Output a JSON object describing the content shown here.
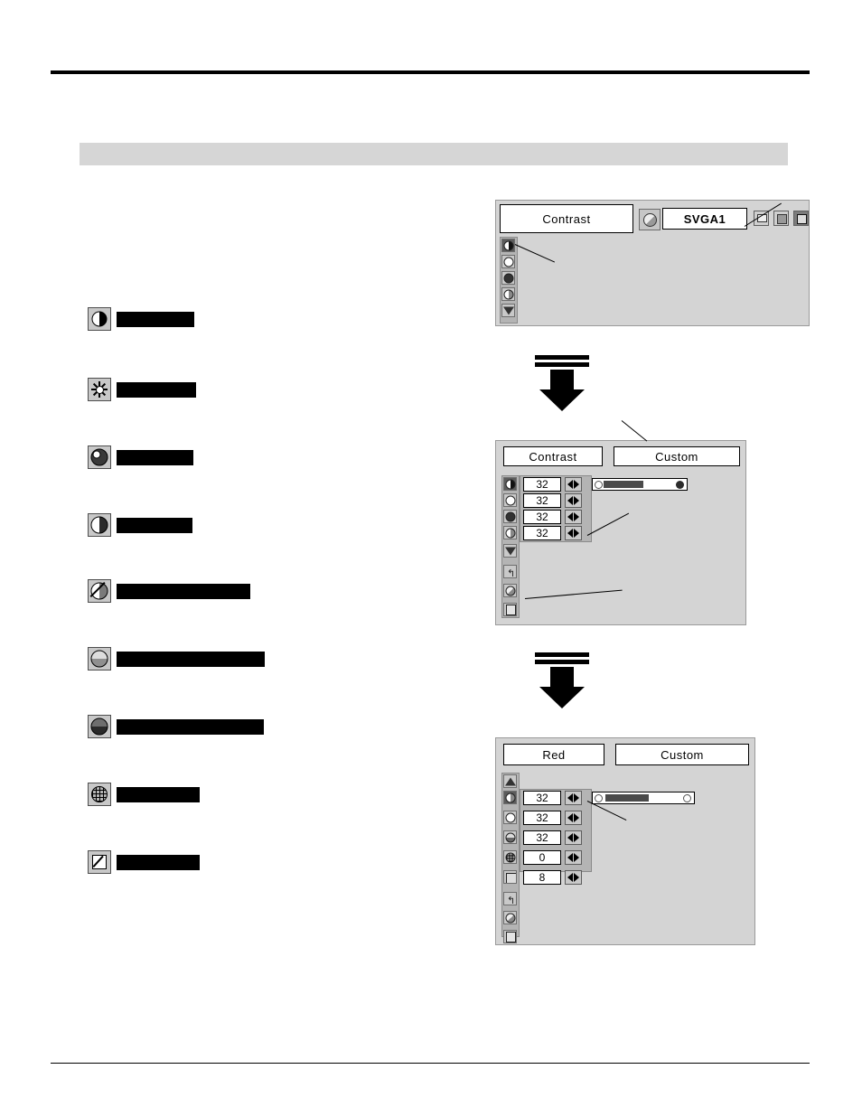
{
  "page": {
    "heading_band_label": "",
    "features": [
      {
        "icon": "contrast-icon",
        "label": ""
      },
      {
        "icon": "brightness-icon",
        "label": ""
      },
      {
        "icon": "color-icon",
        "label": ""
      },
      {
        "icon": "tint-icon",
        "label": ""
      },
      {
        "icon": "white-balance-red-icon",
        "label": ""
      },
      {
        "icon": "white-balance-green-icon",
        "label": ""
      },
      {
        "icon": "white-balance-blue-icon",
        "label": ""
      },
      {
        "icon": "sharpness-icon",
        "label": ""
      },
      {
        "icon": "gamma-icon",
        "label": ""
      }
    ]
  },
  "osd_top": {
    "title": "Contrast",
    "source": "SVGA1",
    "menu_icons": [
      "contrast-icon",
      "brightness-icon",
      "color-icon",
      "tint-icon",
      "arrow-down-icon"
    ],
    "toolbar_icons": [
      "pc-icon",
      "video-icon",
      "image-icon"
    ]
  },
  "osd_mid": {
    "title": "Contrast",
    "mode": "Custom",
    "rows": [
      {
        "icon": "contrast-icon",
        "value": "32"
      },
      {
        "icon": "brightness-icon",
        "value": "32"
      },
      {
        "icon": "color-icon",
        "value": "32"
      },
      {
        "icon": "tint-icon",
        "value": "32"
      }
    ],
    "extra_icons": [
      "arrow-down-icon",
      "reset-icon",
      "store-icon",
      "quit-icon"
    ],
    "slider": {
      "value": 32,
      "min": 0,
      "max": 63
    }
  },
  "osd_bottom": {
    "title": "Red",
    "mode": "Custom",
    "rows": [
      {
        "icon": "white-balance-red-icon",
        "value": "32"
      },
      {
        "icon": "white-balance-green-icon",
        "value": "32"
      },
      {
        "icon": "white-balance-blue-icon",
        "value": "32"
      },
      {
        "icon": "sharpness-icon",
        "value": "0"
      },
      {
        "icon": "gamma-icon",
        "value": "8"
      }
    ],
    "extra_icons": [
      "arrow-up-icon",
      "reset-icon",
      "store-icon",
      "quit-icon"
    ],
    "slider": {
      "value": 32,
      "min": 0,
      "max": 63
    }
  }
}
